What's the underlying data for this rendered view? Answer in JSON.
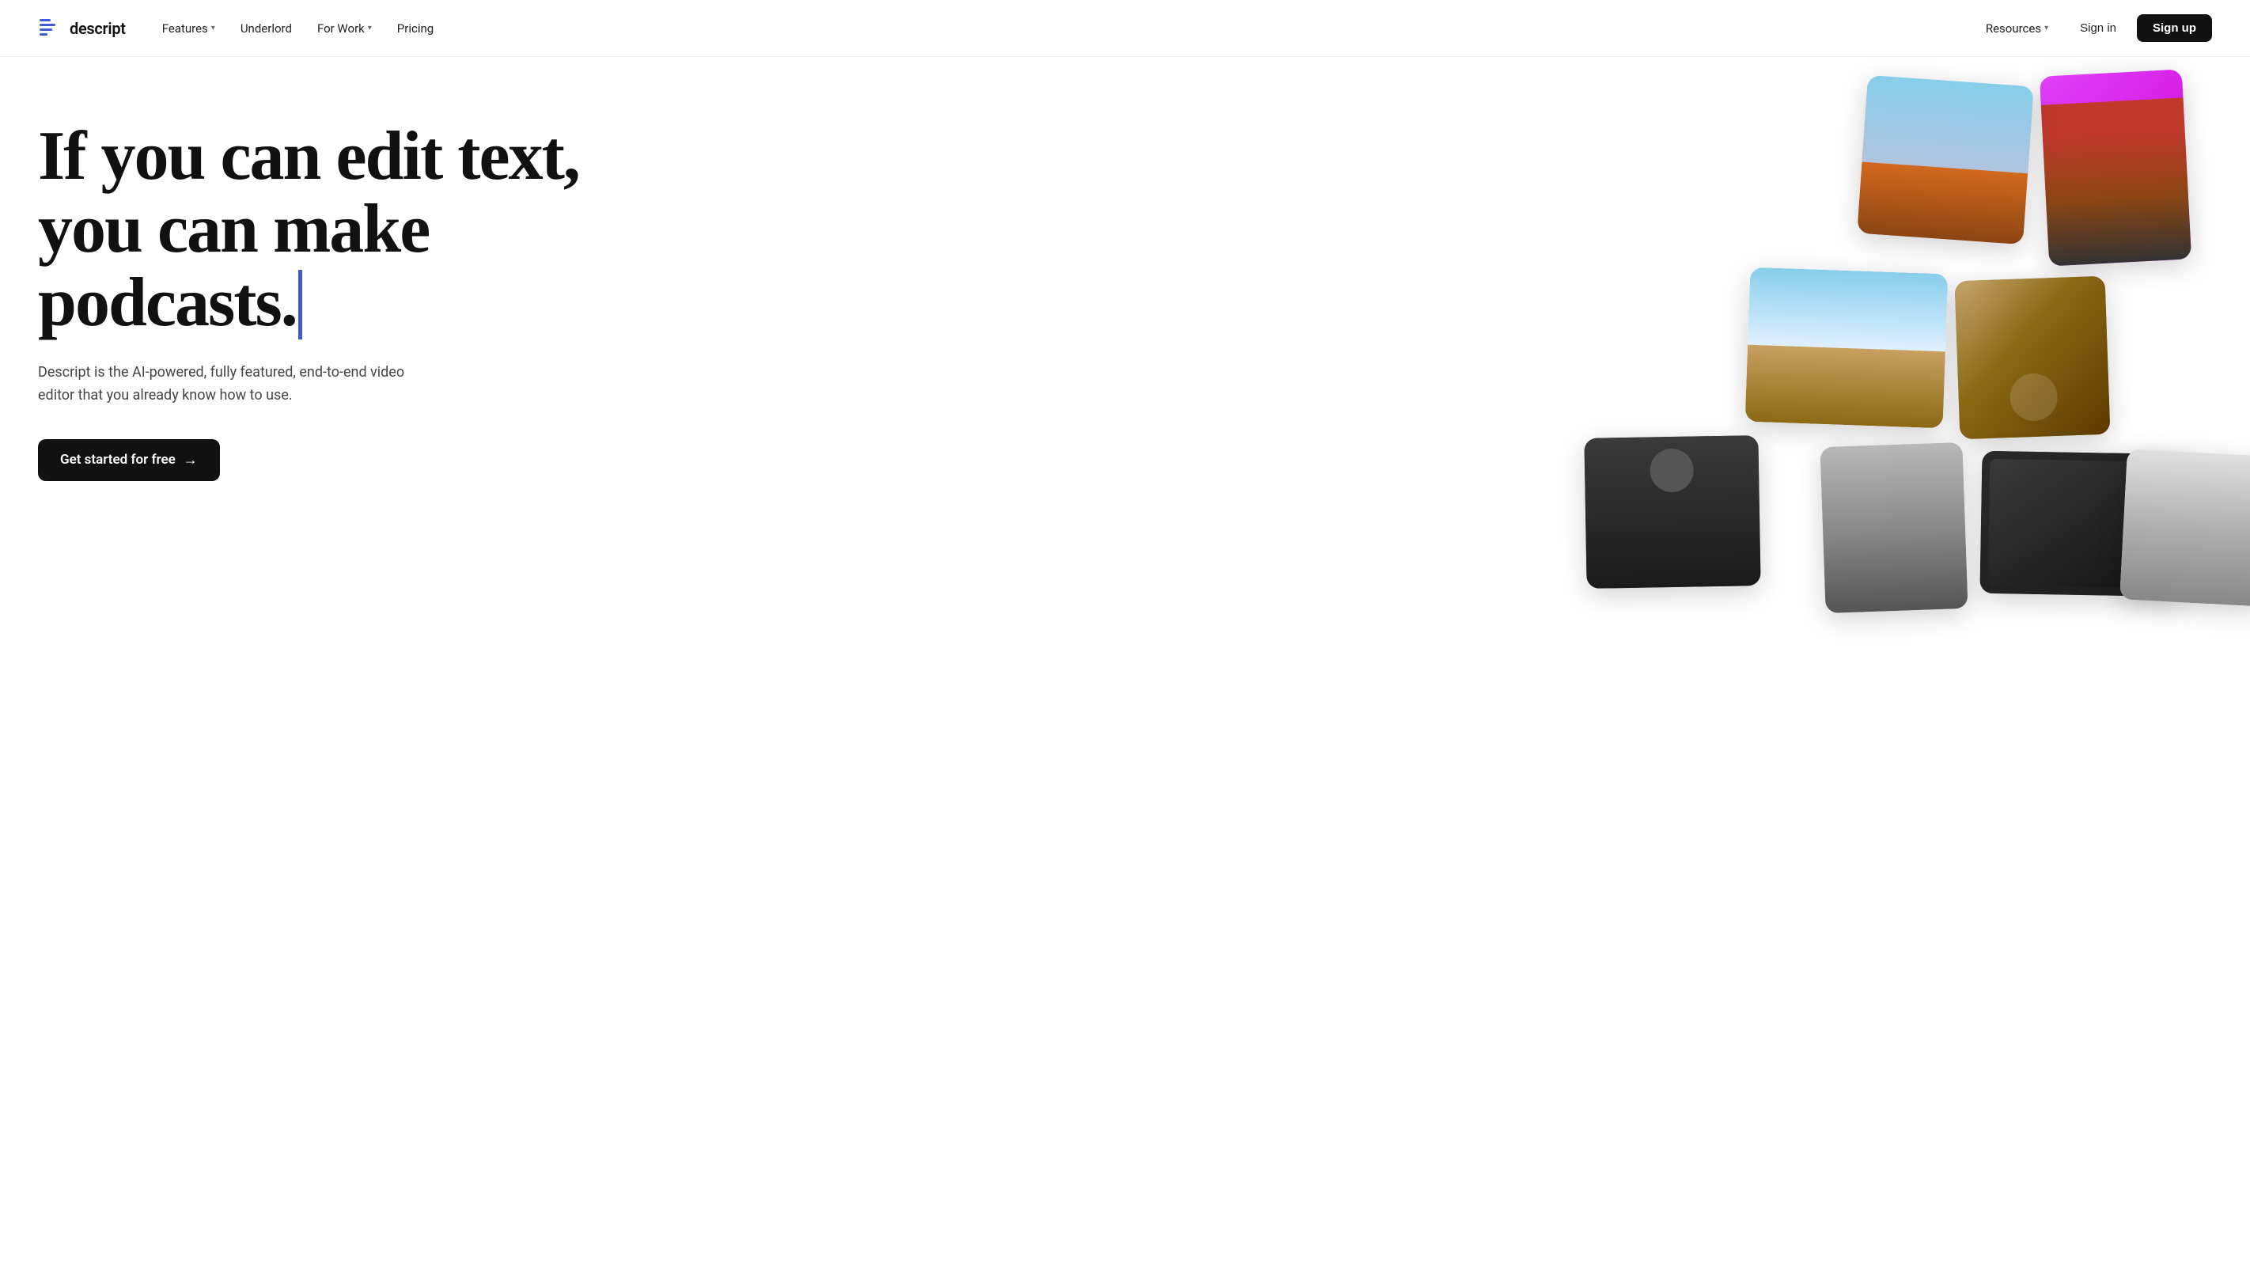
{
  "logo": {
    "text": "descript"
  },
  "nav": {
    "features_label": "Features",
    "underlord_label": "Underlord",
    "for_work_label": "For Work",
    "pricing_label": "Pricing",
    "resources_label": "Resources",
    "sign_in_label": "Sign in",
    "sign_up_label": "Sign up"
  },
  "hero": {
    "headline_line1": "If you can edit text,",
    "headline_line2": "you can make podcasts.",
    "subtext": "Descript is the AI-powered, fully featured, end-to-end video editor that you already know how to use.",
    "cta_label": "Get started for free",
    "cta_arrow": "→"
  }
}
